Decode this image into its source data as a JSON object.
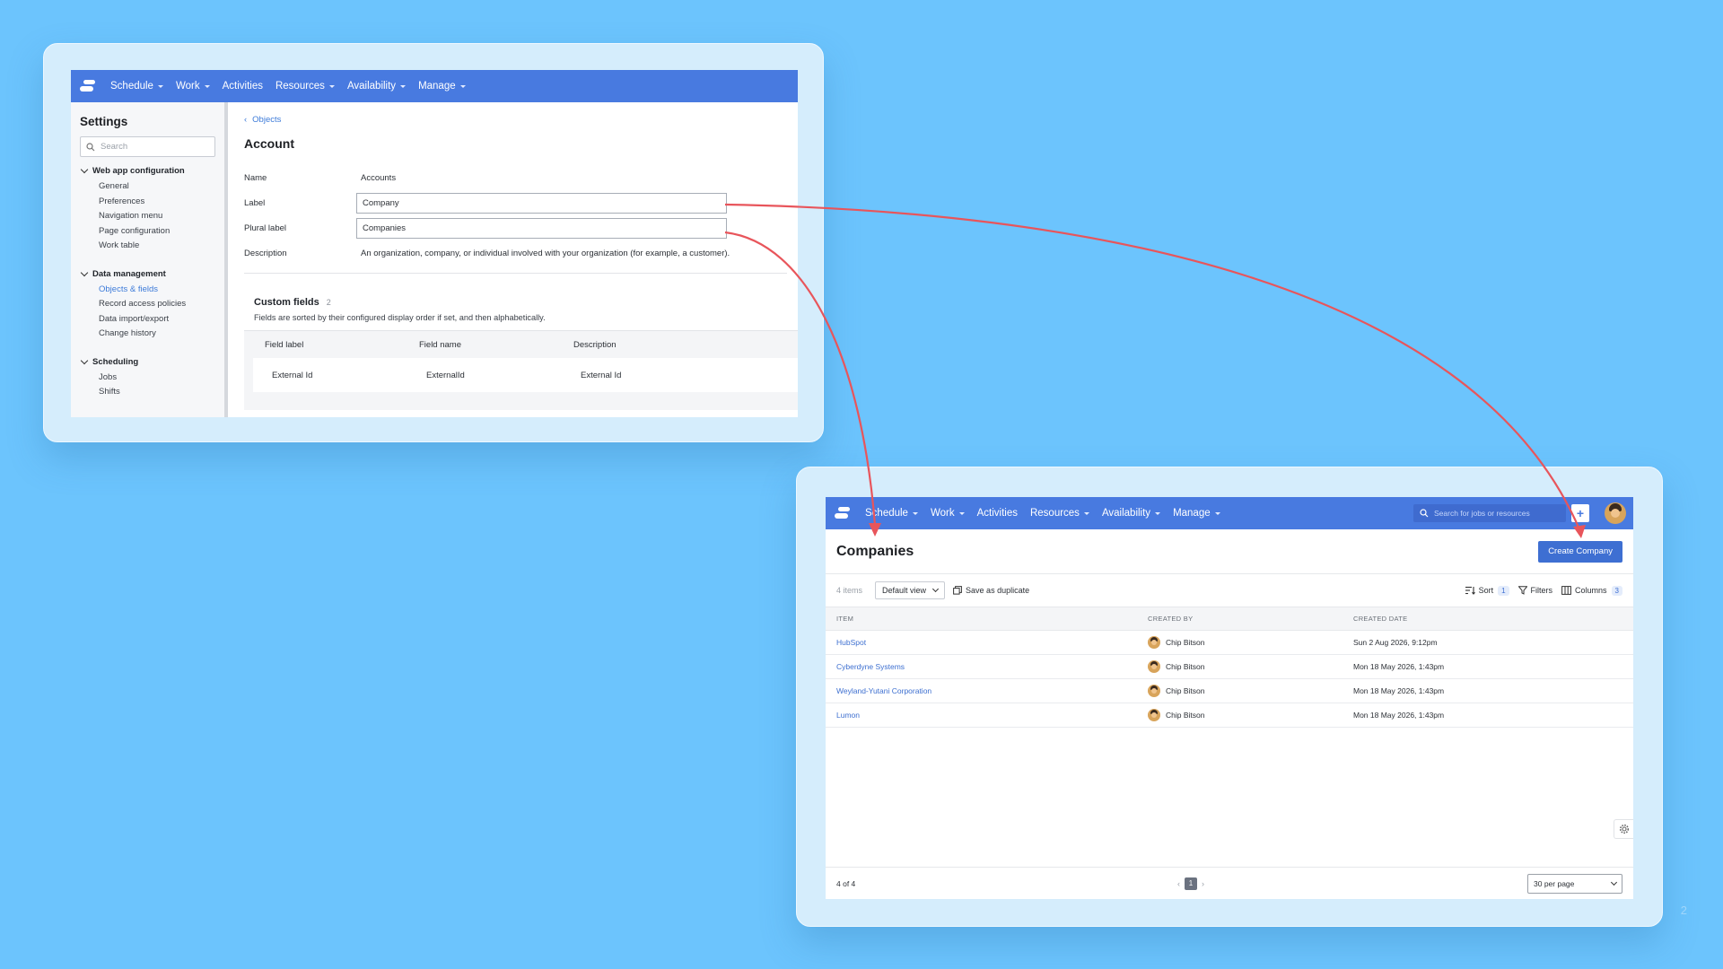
{
  "nav": {
    "items": [
      "Schedule",
      "Work",
      "Activities",
      "Resources",
      "Availability",
      "Manage"
    ],
    "has_caret": [
      true,
      true,
      false,
      true,
      true,
      true
    ]
  },
  "settings": {
    "title": "Settings",
    "search_placeholder": "Search",
    "groups": [
      {
        "label": "Web app configuration",
        "items": [
          "General",
          "Preferences",
          "Navigation menu",
          "Page configuration",
          "Work table"
        ]
      },
      {
        "label": "Data management",
        "items": [
          "Objects & fields",
          "Record access policies",
          "Data import/export",
          "Change history"
        ]
      },
      {
        "label": "Scheduling",
        "items": [
          "Jobs",
          "Shifts"
        ]
      }
    ],
    "active_item": "Objects & fields",
    "breadcrumb": "Objects",
    "heading": "Account",
    "fields": {
      "name_label": "Name",
      "name_value": "Accounts",
      "label_label": "Label",
      "label_value": "Company",
      "plural_label": "Plural label",
      "plural_value": "Companies",
      "description_label": "Description",
      "description_value": "An organization, company, or individual involved with your organization (for example, a customer)."
    },
    "custom_fields": {
      "title": "Custom fields",
      "count": "2",
      "subtitle": "Fields are sorted by their configured display order if set, and then alphabetically.",
      "columns": [
        "Field label",
        "Field name",
        "Description"
      ],
      "rows": [
        [
          "External Id",
          "ExternalId",
          "External Id"
        ]
      ]
    }
  },
  "companies": {
    "search_placeholder": "Search for jobs or resources",
    "plus_label": "+",
    "title": "Companies",
    "create_button": "Create Company",
    "items_count": "4 items",
    "view": "Default view",
    "save_duplicate": "Save as duplicate",
    "sort_label": "Sort",
    "sort_count": "1",
    "filters_label": "Filters",
    "columns_label": "Columns",
    "columns_count": "3",
    "table_headers": [
      "ITEM",
      "CREATED BY",
      "CREATED DATE"
    ],
    "rows": [
      {
        "item": "HubSpot",
        "created_by": "Chip Bitson",
        "created_date": "Sun 2 Aug 2026, 9:12pm"
      },
      {
        "item": "Cyberdyne Systems",
        "created_by": "Chip Bitson",
        "created_date": "Mon 18 May 2026, 1:43pm"
      },
      {
        "item": "Weyland-Yutani Corporation",
        "created_by": "Chip Bitson",
        "created_date": "Mon 18 May 2026, 1:43pm"
      },
      {
        "item": "Lumon",
        "created_by": "Chip Bitson",
        "created_date": "Mon 18 May 2026, 1:43pm"
      }
    ],
    "footer_count": "4 of 4",
    "current_page": "1",
    "per_page": "30 per page"
  },
  "slide_number": "2",
  "colors": {
    "background": "#6cc4fd",
    "nav": "#487ae0",
    "accent": "#3e6fd2",
    "arrow": "#e8555b"
  }
}
